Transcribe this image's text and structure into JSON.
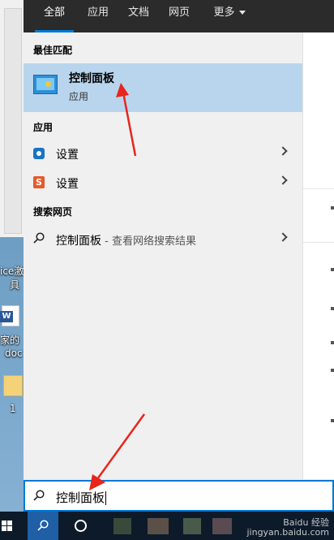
{
  "tabs": [
    "全部",
    "应用",
    "文档",
    "网页",
    "更多"
  ],
  "sections": {
    "best_match": "最佳匹配",
    "apps": "应用",
    "web": "搜索网页"
  },
  "best_match": {
    "title": "控制面板",
    "subtitle": "应用"
  },
  "app_results": [
    {
      "label": "设置",
      "icon": "gear-icon"
    },
    {
      "label": "设置",
      "icon": "s-app-icon"
    }
  ],
  "web_result": {
    "label": "控制面板",
    "suffix": " - 查看网络搜索结果"
  },
  "search": {
    "query": "控制面板"
  },
  "desktop": {
    "labels": [
      "ice激",
      "具",
      "家的",
      "doc",
      "1"
    ]
  },
  "watermark": [
    "Baidu 经验",
    "jingyan.baidu.com"
  ],
  "colors": {
    "accent": "#0078d7",
    "selected_bg": "#b9d5ed",
    "annotation_arrow": "#e8251c"
  }
}
